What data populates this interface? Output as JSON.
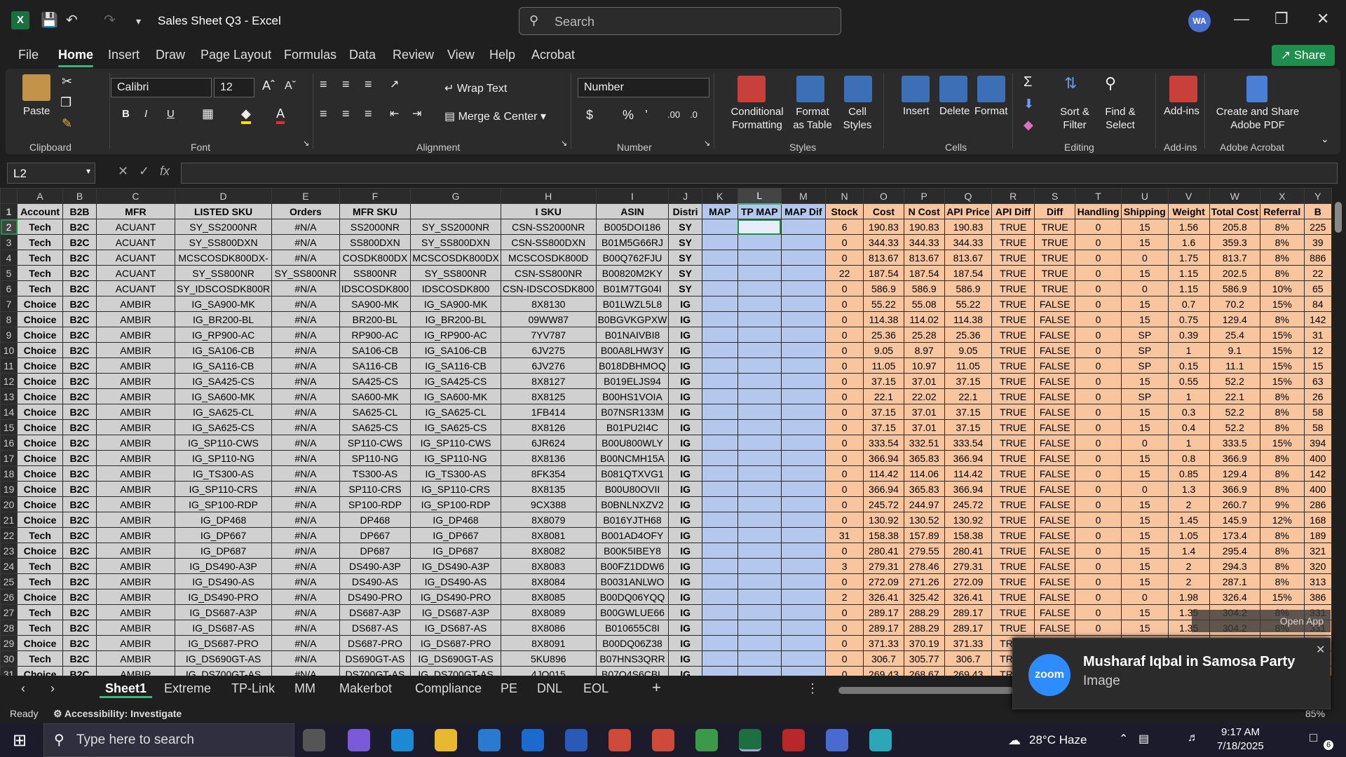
{
  "app": {
    "title": "Sales Sheet Q3  -  Excel",
    "avatar": "WA",
    "search_placeholder": "Search",
    "share": "Share"
  },
  "menu": [
    "File",
    "Home",
    "Insert",
    "Draw",
    "Page Layout",
    "Formulas",
    "Data",
    "Review",
    "View",
    "Help",
    "Acrobat"
  ],
  "ribbon": {
    "clipboard": {
      "paste": "Paste",
      "group": "Clipboard"
    },
    "font": {
      "name": "Calibri",
      "size": "12",
      "group": "Font"
    },
    "alignment": {
      "wrap": "Wrap Text",
      "merge": "Merge & Center",
      "group": "Alignment"
    },
    "number": {
      "format": "Number",
      "group": "Number"
    },
    "styles": {
      "conditional": "Conditional Formatting",
      "format_table": "Format as Table",
      "cell_styles": "Cell Styles",
      "group": "Styles"
    },
    "cells": {
      "insert": "Insert",
      "delete": "Delete",
      "format": "Format",
      "group": "Cells"
    },
    "editing": {
      "sort": "Sort & Filter",
      "find": "Find & Select",
      "group": "Editing"
    },
    "addins": {
      "label": "Add-ins",
      "group": "Add-ins"
    },
    "acrobat": {
      "label": "Create and Share Adobe PDF",
      "group": "Adobe Acrobat"
    }
  },
  "formula_bar": {
    "name_box": "L2",
    "fx": "fx",
    "value": ""
  },
  "columns": [
    "A",
    "B",
    "C",
    "D",
    "E",
    "F",
    "G",
    "H",
    "I",
    "J",
    "K",
    "L",
    "M",
    "N",
    "O",
    "P",
    "Q",
    "R",
    "S",
    "T",
    "U",
    "V",
    "W",
    "X",
    "Y"
  ],
  "header_row": [
    "Account",
    "B2B",
    "MFR",
    "LISTED SKU",
    "Orders",
    "MFR SKU",
    "",
    "I SKU",
    "ASIN",
    "Distri",
    "MAP",
    "TP MAP",
    "MAP Dif",
    "Stock",
    "Cost",
    "N Cost",
    "API Price",
    "API Diff",
    "Diff",
    "Handling",
    "Shipping",
    "Weight",
    "Total Cost",
    "Referral",
    "B"
  ],
  "rows": [
    [
      "Tech",
      "B2C",
      "ACUANT",
      "SY_SS2000NR",
      "#N/A",
      "SS2000NR",
      "SY_SS2000NR",
      "CSN-SS2000NR",
      "B005DOI186",
      "SY",
      "",
      "",
      "",
      "6",
      "190.83",
      "190.83",
      "190.83",
      "TRUE",
      "TRUE",
      "0",
      "15",
      "1.56",
      "205.8",
      "8%",
      "225"
    ],
    [
      "Tech",
      "B2C",
      "ACUANT",
      "SY_SS800DXN",
      "#N/A",
      "SS800DXN",
      "SY_SS800DXN",
      "CSN-SS800DXN",
      "B01M5G66RJ",
      "SY",
      "",
      "",
      "",
      "0",
      "344.33",
      "344.33",
      "344.33",
      "TRUE",
      "TRUE",
      "0",
      "15",
      "1.6",
      "359.3",
      "8%",
      "39"
    ],
    [
      "Tech",
      "B2C",
      "ACUANT",
      "MCSCOSDK800DX-",
      "#N/A",
      "COSDK800DX",
      "MCSCOSDK800DX",
      "MCSCOSDK800D",
      "B00Q762FJU",
      "SY",
      "",
      "",
      "",
      "0",
      "813.67",
      "813.67",
      "813.67",
      "TRUE",
      "TRUE",
      "0",
      "0",
      "1.75",
      "813.7",
      "8%",
      "886"
    ],
    [
      "Tech",
      "B2C",
      "ACUANT",
      "SY_SS800NR",
      "SY_SS800NR",
      "SS800NR",
      "SY_SS800NR",
      "CSN-SS800NR",
      "B00820M2KY",
      "SY",
      "",
      "",
      "",
      "22",
      "187.54",
      "187.54",
      "187.54",
      "TRUE",
      "TRUE",
      "0",
      "15",
      "1.15",
      "202.5",
      "8%",
      "22"
    ],
    [
      "Tech",
      "B2C",
      "ACUANT",
      "SY_IDSCOSDK800R",
      "#N/A",
      "IDSCOSDK800",
      "IDSCOSDK800",
      "CSN-IDSCOSDK800",
      "B01M7TG04I",
      "SY",
      "",
      "",
      "",
      "0",
      "586.9",
      "586.9",
      "586.9",
      "TRUE",
      "TRUE",
      "0",
      "0",
      "1.15",
      "586.9",
      "10%",
      "65"
    ],
    [
      "Choice",
      "B2C",
      "AMBIR",
      "IG_SA900-MK",
      "#N/A",
      "SA900-MK",
      "IG_SA900-MK",
      "8X8130",
      "B01LWZL5L8",
      "IG",
      "",
      "",
      "",
      "0",
      "55.22",
      "55.08",
      "55.22",
      "TRUE",
      "FALSE",
      "0",
      "15",
      "0.7",
      "70.2",
      "15%",
      "84"
    ],
    [
      "Choice",
      "B2C",
      "AMBIR",
      "IG_BR200-BL",
      "#N/A",
      "BR200-BL",
      "IG_BR200-BL",
      "09WW87",
      "B0BGVKGPXW",
      "IG",
      "",
      "",
      "",
      "0",
      "114.38",
      "114.02",
      "114.38",
      "TRUE",
      "FALSE",
      "0",
      "15",
      "0.75",
      "129.4",
      "8%",
      "142"
    ],
    [
      "Choice",
      "B2C",
      "AMBIR",
      "IG_RP900-AC",
      "#N/A",
      "RP900-AC",
      "IG_RP900-AC",
      "7YV787",
      "B01NAIVBI8",
      "IG",
      "",
      "",
      "",
      "0",
      "25.36",
      "25.28",
      "25.36",
      "TRUE",
      "FALSE",
      "0",
      "SP",
      "0.39",
      "25.4",
      "15%",
      "31"
    ],
    [
      "Choice",
      "B2C",
      "AMBIR",
      "IG_SA106-CB",
      "#N/A",
      "SA106-CB",
      "IG_SA106-CB",
      "6JV275",
      "B00A8LHW3Y",
      "IG",
      "",
      "",
      "",
      "0",
      "9.05",
      "8.97",
      "9.05",
      "TRUE",
      "FALSE",
      "0",
      "SP",
      "1",
      "9.1",
      "15%",
      "12"
    ],
    [
      "Choice",
      "B2C",
      "AMBIR",
      "IG_SA116-CB",
      "#N/A",
      "SA116-CB",
      "IG_SA116-CB",
      "6JV276",
      "B018DBHMOQ",
      "IG",
      "",
      "",
      "",
      "0",
      "11.05",
      "10.97",
      "11.05",
      "TRUE",
      "FALSE",
      "0",
      "SP",
      "0.15",
      "11.1",
      "15%",
      "15"
    ],
    [
      "Choice",
      "B2C",
      "AMBIR",
      "IG_SA425-CS",
      "#N/A",
      "SA425-CS",
      "IG_SA425-CS",
      "8X8127",
      "B019ELJS94",
      "IG",
      "",
      "",
      "",
      "0",
      "37.15",
      "37.01",
      "37.15",
      "TRUE",
      "FALSE",
      "0",
      "15",
      "0.55",
      "52.2",
      "15%",
      "63"
    ],
    [
      "Choice",
      "B2C",
      "AMBIR",
      "IG_SA600-MK",
      "#N/A",
      "SA600-MK",
      "IG_SA600-MK",
      "8X8125",
      "B00HS1VOIA",
      "IG",
      "",
      "",
      "",
      "0",
      "22.1",
      "22.02",
      "22.1",
      "TRUE",
      "FALSE",
      "0",
      "SP",
      "1",
      "22.1",
      "8%",
      "26"
    ],
    [
      "Choice",
      "B2C",
      "AMBIR",
      "IG_SA625-CL",
      "#N/A",
      "SA625-CL",
      "IG_SA625-CL",
      "1FB414",
      "B07NSR133M",
      "IG",
      "",
      "",
      "",
      "0",
      "37.15",
      "37.01",
      "37.15",
      "TRUE",
      "FALSE",
      "0",
      "15",
      "0.3",
      "52.2",
      "8%",
      "58"
    ],
    [
      "Choice",
      "B2C",
      "AMBIR",
      "IG_SA625-CS",
      "#N/A",
      "SA625-CS",
      "IG_SA625-CS",
      "8X8126",
      "B01PU2I4C",
      "IG",
      "",
      "",
      "",
      "0",
      "37.15",
      "37.01",
      "37.15",
      "TRUE",
      "FALSE",
      "0",
      "15",
      "0.4",
      "52.2",
      "8%",
      "58"
    ],
    [
      "Choice",
      "B2C",
      "AMBIR",
      "IG_SP110-CWS",
      "#N/A",
      "SP110-CWS",
      "IG_SP110-CWS",
      "6JR624",
      "B00U800WLY",
      "IG",
      "",
      "",
      "",
      "0",
      "333.54",
      "332.51",
      "333.54",
      "TRUE",
      "FALSE",
      "0",
      "0",
      "1",
      "333.5",
      "15%",
      "394"
    ],
    [
      "Choice",
      "B2C",
      "AMBIR",
      "IG_SP110-NG",
      "#N/A",
      "SP110-NG",
      "IG_SP110-NG",
      "8X8136",
      "B00NCMH15A",
      "IG",
      "",
      "",
      "",
      "0",
      "366.94",
      "365.83",
      "366.94",
      "TRUE",
      "FALSE",
      "0",
      "15",
      "0.8",
      "366.9",
      "8%",
      "400"
    ],
    [
      "Choice",
      "B2C",
      "AMBIR",
      "IG_TS300-AS",
      "#N/A",
      "TS300-AS",
      "IG_TS300-AS",
      "8FK354",
      "B081QTXVG1",
      "IG",
      "",
      "",
      "",
      "0",
      "114.42",
      "114.06",
      "114.42",
      "TRUE",
      "FALSE",
      "0",
      "15",
      "0.85",
      "129.4",
      "8%",
      "142"
    ],
    [
      "Choice",
      "B2C",
      "AMBIR",
      "IG_SP110-CRS",
      "#N/A",
      "SP110-CRS",
      "IG_SP110-CRS",
      "8X8135",
      "B00U80OVII",
      "IG",
      "",
      "",
      "",
      "0",
      "366.94",
      "365.83",
      "366.94",
      "TRUE",
      "FALSE",
      "0",
      "0",
      "1.3",
      "366.9",
      "8%",
      "400"
    ],
    [
      "Choice",
      "B2C",
      "AMBIR",
      "IG_SP100-RDP",
      "#N/A",
      "SP100-RDP",
      "IG_SP100-RDP",
      "9CX388",
      "B0BNLNXZV2",
      "IG",
      "",
      "",
      "",
      "0",
      "245.72",
      "244.97",
      "245.72",
      "TRUE",
      "FALSE",
      "0",
      "15",
      "2",
      "260.7",
      "9%",
      "286"
    ],
    [
      "Choice",
      "B2C",
      "AMBIR",
      "IG_DP468",
      "#N/A",
      "DP468",
      "IG_DP468",
      "8X8079",
      "B016YJTH68",
      "IG",
      "",
      "",
      "",
      "0",
      "130.92",
      "130.52",
      "130.92",
      "TRUE",
      "FALSE",
      "0",
      "15",
      "1.45",
      "145.9",
      "12%",
      "168"
    ],
    [
      "Tech",
      "B2C",
      "AMBIR",
      "IG_DP667",
      "#N/A",
      "DP667",
      "IG_DP667",
      "8X8081",
      "B001AD4OFY",
      "IG",
      "",
      "",
      "",
      "31",
      "158.38",
      "157.89",
      "158.38",
      "TRUE",
      "FALSE",
      "0",
      "15",
      "1.05",
      "173.4",
      "8%",
      "189"
    ],
    [
      "Choice",
      "B2C",
      "AMBIR",
      "IG_DP687",
      "#N/A",
      "DP687",
      "IG_DP687",
      "8X8082",
      "B00K5IBEY8",
      "IG",
      "",
      "",
      "",
      "0",
      "280.41",
      "279.55",
      "280.41",
      "TRUE",
      "FALSE",
      "0",
      "15",
      "1.4",
      "295.4",
      "8%",
      "321"
    ],
    [
      "Tech",
      "B2C",
      "AMBIR",
      "IG_DS490-A3P",
      "#N/A",
      "DS490-A3P",
      "IG_DS490-A3P",
      "8X8083",
      "B00FZ1DDW6",
      "IG",
      "",
      "",
      "",
      "3",
      "279.31",
      "278.46",
      "279.31",
      "TRUE",
      "FALSE",
      "0",
      "15",
      "2",
      "294.3",
      "8%",
      "320"
    ],
    [
      "Tech",
      "B2C",
      "AMBIR",
      "IG_DS490-AS",
      "#N/A",
      "DS490-AS",
      "IG_DS490-AS",
      "8X8084",
      "B0031ANLWO",
      "IG",
      "",
      "",
      "",
      "0",
      "272.09",
      "271.26",
      "272.09",
      "TRUE",
      "FALSE",
      "0",
      "15",
      "2",
      "287.1",
      "8%",
      "313"
    ],
    [
      "Choice",
      "B2C",
      "AMBIR",
      "IG_DS490-PRO",
      "#N/A",
      "DS490-PRO",
      "IG_DS490-PRO",
      "8X8085",
      "B00DQ06YQQ",
      "IG",
      "",
      "",
      "",
      "2",
      "326.41",
      "325.42",
      "326.41",
      "TRUE",
      "FALSE",
      "0",
      "0",
      "1.98",
      "326.4",
      "15%",
      "386"
    ],
    [
      "Tech",
      "B2C",
      "AMBIR",
      "IG_DS687-A3P",
      "#N/A",
      "DS687-A3P",
      "IG_DS687-A3P",
      "8X8089",
      "B00GWLUE66",
      "IG",
      "",
      "",
      "",
      "0",
      "289.17",
      "288.29",
      "289.17",
      "TRUE",
      "FALSE",
      "0",
      "15",
      "1.35",
      "304.2",
      "8%",
      "331"
    ],
    [
      "Tech",
      "B2C",
      "AMBIR",
      "IG_DS687-AS",
      "#N/A",
      "DS687-AS",
      "IG_DS687-AS",
      "8X8086",
      "B010655C8I",
      "IG",
      "",
      "",
      "",
      "0",
      "289.17",
      "288.29",
      "289.17",
      "TRUE",
      "FALSE",
      "0",
      "15",
      "1.35",
      "304.2",
      "8%",
      "331"
    ],
    [
      "Choice",
      "B2C",
      "AMBIR",
      "IG_DS687-PRO",
      "#N/A",
      "DS687-PRO",
      "IG_DS687-PRO",
      "8X8091",
      "B00DQ06Z38",
      "IG",
      "",
      "",
      "",
      "0",
      "371.33",
      "370.19",
      "371.33",
      "TRUE",
      "FALSE",
      "",
      "",
      "",
      "",
      "",
      ""
    ],
    [
      "Tech",
      "B2C",
      "AMBIR",
      "IG_DS690GT-AS",
      "#N/A",
      "DS690GT-AS",
      "IG_DS690GT-AS",
      "5KU896",
      "B07HNS3QRR",
      "IG",
      "",
      "",
      "",
      "0",
      "306.7",
      "305.77",
      "306.7",
      "TRUE",
      "",
      "",
      "",
      "",
      "",
      "",
      ""
    ],
    [
      "Choice",
      "B2C",
      "AMBIR",
      "IG_DS700GT-AS",
      "#N/A",
      "DS700GT-AS",
      "IG_DS700GT-AS",
      "4JQ015",
      "B07Q4S6CBL",
      "IG",
      "",
      "",
      "",
      "0",
      "269.43",
      "268.67",
      "269.43",
      "TRUE",
      "",
      "",
      "",
      "",
      "",
      "",
      ""
    ]
  ],
  "sheet_tabs": [
    "Sheet1",
    "Extreme",
    "TP-Link",
    "MM",
    "Makerbot",
    "Compliance",
    "PE",
    "DNL",
    "EOL"
  ],
  "status": {
    "ready": "Ready",
    "accessibility": "Accessibility: Investigate",
    "zoom": "85%"
  },
  "taskbar": {
    "search": "Type here to search",
    "weather": "28°C  Haze",
    "time": "9:17 AM",
    "date": "7/18/2025",
    "notif_count": "6"
  },
  "notification": {
    "title": "Musharaf Iqbal in Samosa Party",
    "subtitle": "Image",
    "app": "zoom",
    "open_app": "Open App"
  }
}
